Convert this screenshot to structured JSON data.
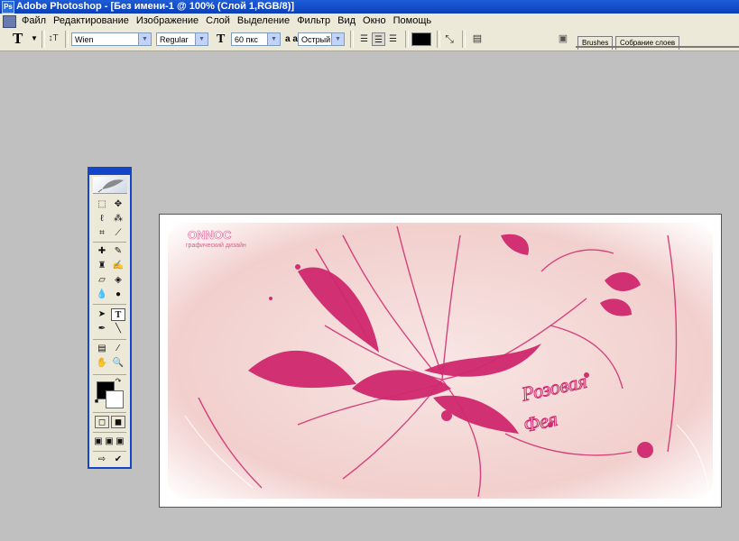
{
  "window": {
    "title": "Adobe Photoshop - [Без имени-1 @ 100% (Слой 1,RGB/8)]"
  },
  "menu": {
    "items": [
      "Файл",
      "Редактирование",
      "Изображение",
      "Слой",
      "Выделение",
      "Фильтр",
      "Вид",
      "Окно",
      "Помощь"
    ]
  },
  "options": {
    "font_family": "Wien",
    "font_style": "Regular",
    "font_size": "60 пкс",
    "antialias": "Острый",
    "aa_label": "a a",
    "text_color": "#000000"
  },
  "palette_well": {
    "tabs": [
      "Brushes",
      "Собрание слоев"
    ]
  },
  "canvas": {
    "logo_text": "ONNOC",
    "logo_sub": "графический дизайн",
    "title_line1": "Розовая",
    "title_line2": "Фея",
    "accent_color": "#d0286e"
  }
}
